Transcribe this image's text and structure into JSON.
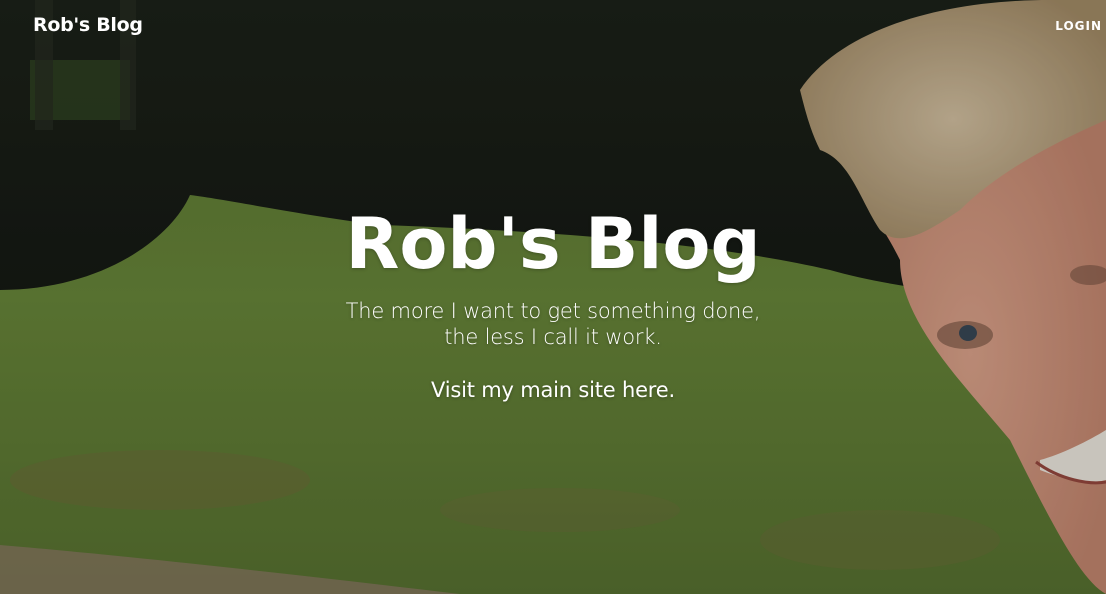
{
  "navbar": {
    "brand": "Rob's Blog",
    "login": "LOGIN"
  },
  "hero": {
    "title": "Rob's Blog",
    "subtitle_line1": "The more I want to get something done,",
    "subtitle_line2": "the less I call it work.",
    "visit_prefix": "Visit my main site",
    "visit_link": "here."
  },
  "colors": {
    "text": "#ffffff",
    "grass": "#6e8a3c",
    "trees": "#1c2218"
  }
}
